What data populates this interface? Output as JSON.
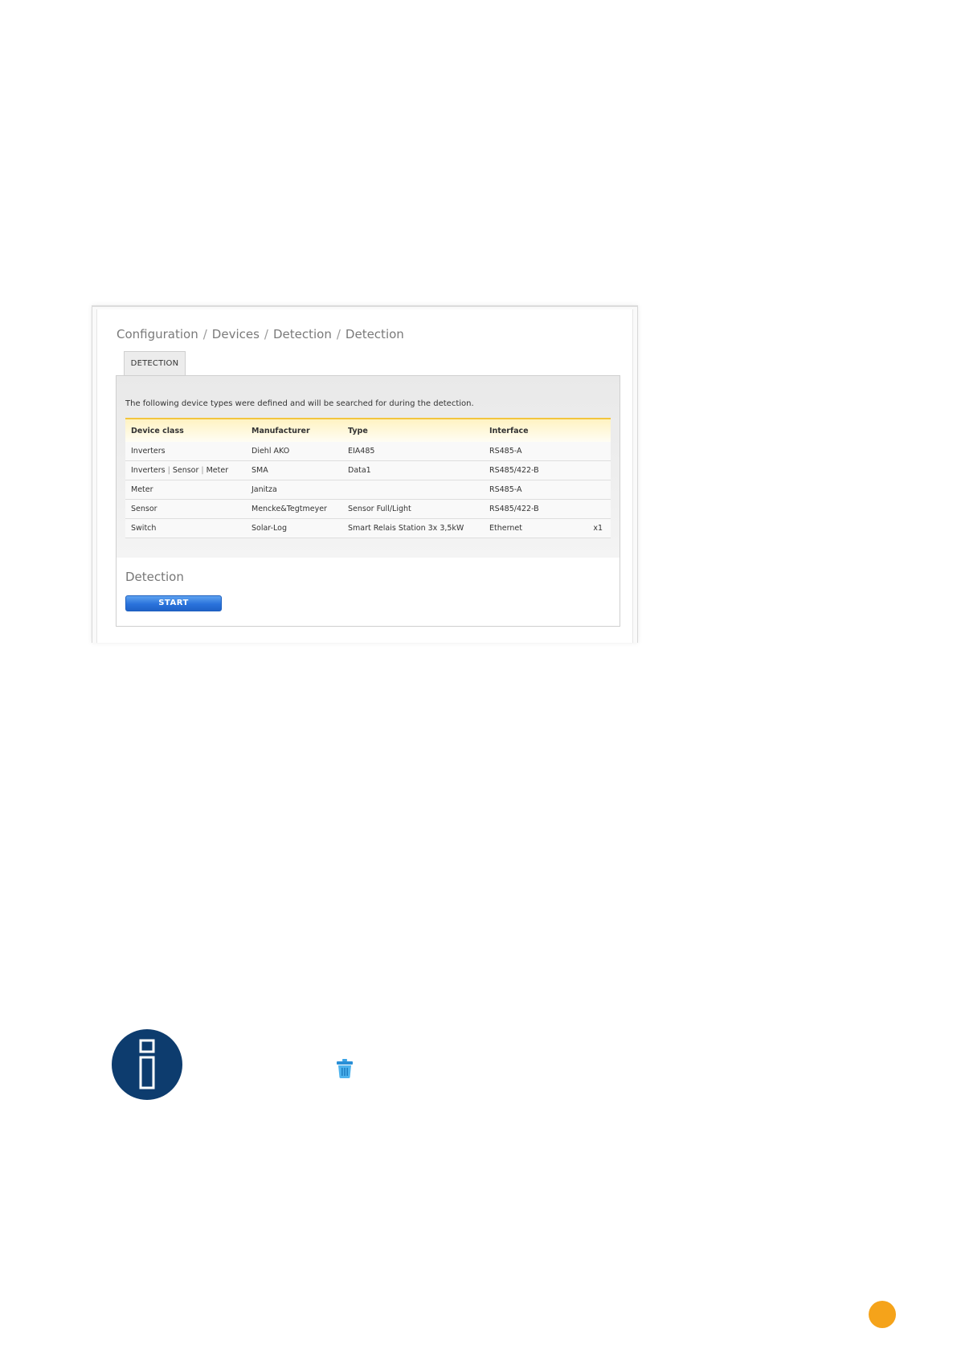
{
  "breadcrumb": {
    "items": [
      "Configuration",
      "Devices",
      "Detection",
      "Detection"
    ],
    "separator": "/"
  },
  "tab": {
    "label": "DETECTION"
  },
  "intro_text": "The following device types were defined and will be searched for during the detection.",
  "table": {
    "headers": [
      "Device class",
      "Manufacturer",
      "Type",
      "Interface"
    ],
    "rows": [
      {
        "device_class": [
          "Inverters"
        ],
        "manufacturer": "Diehl AKO",
        "type": "EIA485",
        "interface": "RS485-A",
        "count": ""
      },
      {
        "device_class": [
          "Inverters",
          "Sensor",
          "Meter"
        ],
        "manufacturer": "SMA",
        "type": "Data1",
        "interface": "RS485/422-B",
        "count": ""
      },
      {
        "device_class": [
          "Meter"
        ],
        "manufacturer": "Janitza",
        "type": "",
        "interface": "RS485-A",
        "count": ""
      },
      {
        "device_class": [
          "Sensor"
        ],
        "manufacturer": "Mencke&Tegtmeyer",
        "type": "Sensor Full/Light",
        "interface": "RS485/422-B",
        "count": ""
      },
      {
        "device_class": [
          "Switch"
        ],
        "manufacturer": "Solar-Log",
        "type": "Smart Relais Station 3x 3,5kW",
        "interface": "Ethernet",
        "count": "x1"
      }
    ]
  },
  "detection": {
    "title": "Detection",
    "start_label": "START"
  },
  "icons": {
    "info": "info-icon",
    "trash": "trash-icon"
  },
  "colors": {
    "start_button": "#2a72db",
    "header_accent": "#f2c53d",
    "info_badge": "#0d3c6e",
    "page_marker": "#f5a31a",
    "trash": "#3aa3e6"
  }
}
